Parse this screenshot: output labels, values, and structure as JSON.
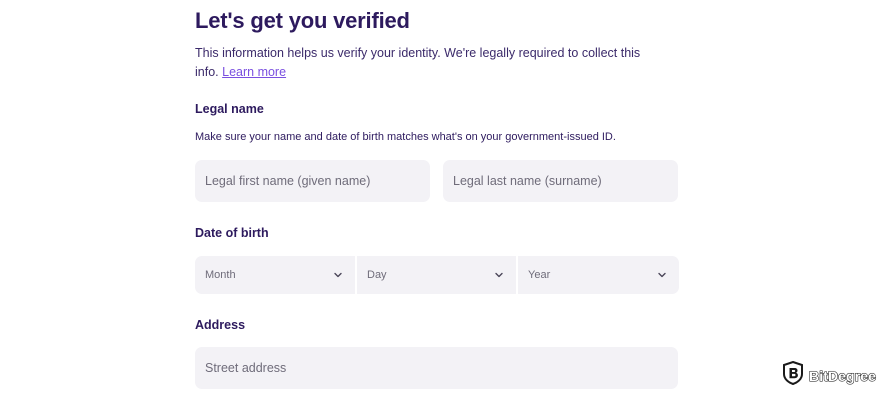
{
  "header": {
    "title": "Let's get you verified",
    "intro_line1": "This information helps us verify your identity. We're legally required to collect this",
    "intro_line2": "info.",
    "learn_more": "Learn more"
  },
  "legal_name": {
    "label": "Legal name",
    "helper": "Make sure your name and date of birth matches what's on your government-issued ID.",
    "first_placeholder": "Legal first name (given name)",
    "last_placeholder": "Legal last name (surname)"
  },
  "date_of_birth": {
    "label": "Date of birth",
    "month": "Month",
    "day": "Day",
    "year": "Year"
  },
  "address": {
    "label": "Address",
    "street_placeholder": "Street address"
  },
  "watermark": {
    "text": "BitDegree",
    "icon": "bitdegree-logo-icon"
  },
  "colors": {
    "title": "#2d1a5e",
    "link": "#7a4fe0",
    "field_bg": "#f3f2f6",
    "placeholder": "#6f6c7a"
  }
}
